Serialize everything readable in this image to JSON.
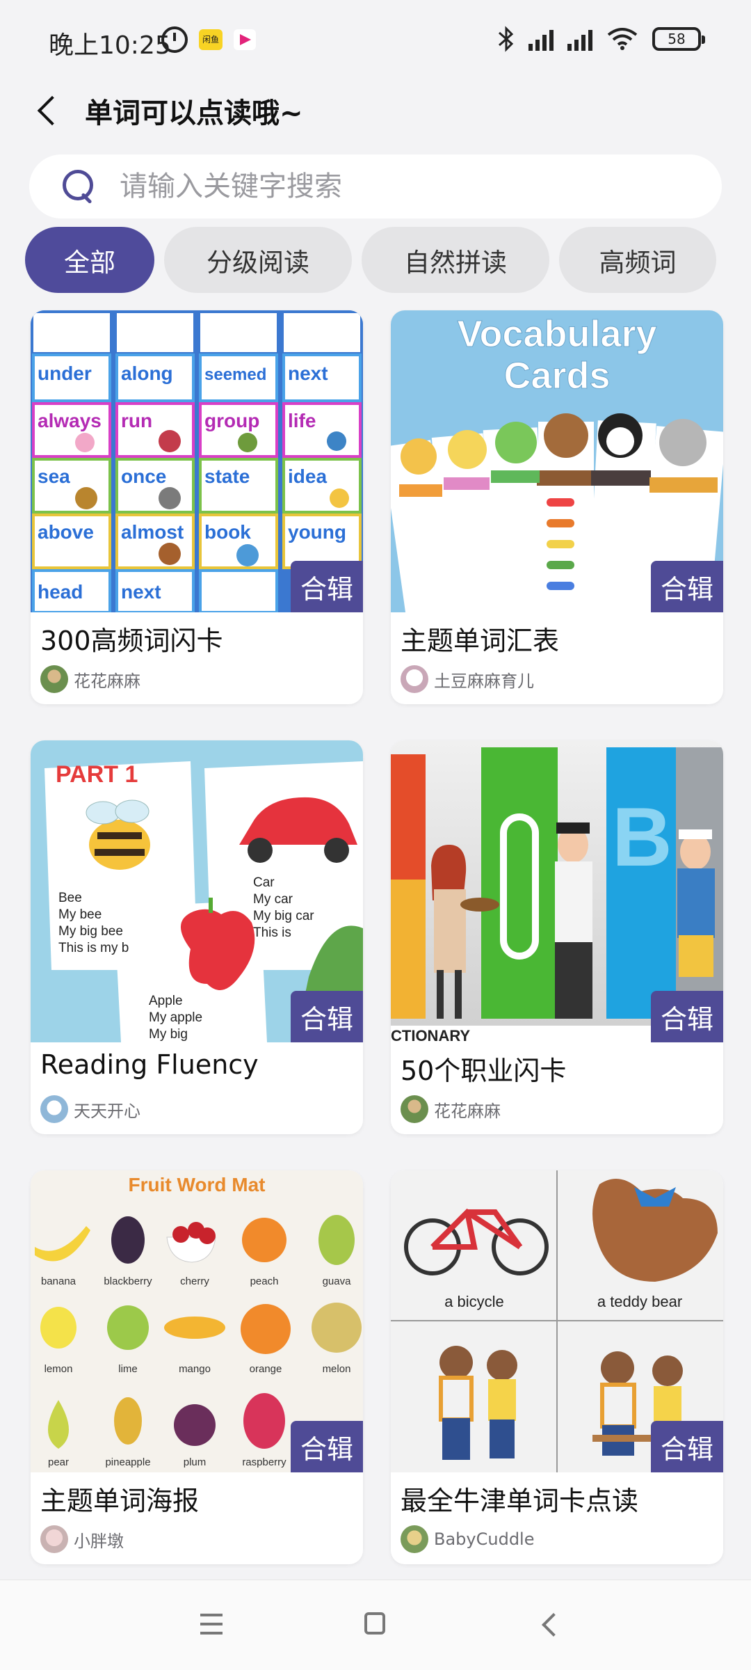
{
  "status_bar": {
    "time": "晚上10:25",
    "app1_badge": "闲鱼",
    "battery": "58"
  },
  "header": {
    "title": "单词可以点读哦~"
  },
  "search": {
    "placeholder": "请输入关键字搜索"
  },
  "tabs": [
    {
      "label": "全部",
      "active": true
    },
    {
      "label": "分级阅读",
      "active": false
    },
    {
      "label": "自然拼读",
      "active": false
    },
    {
      "label": "高频词",
      "active": false
    }
  ],
  "cards": [
    {
      "title": "300高频词闪卡",
      "badge": "合辑",
      "author": "花花麻麻"
    },
    {
      "title": "主题单词汇表",
      "badge": "合辑",
      "author": "土豆麻麻育儿"
    },
    {
      "title": "Reading Fluency",
      "badge": "合辑",
      "author": "天天开心"
    },
    {
      "title": "50个职业闪卡",
      "badge": "合辑",
      "author": "花花麻麻"
    },
    {
      "title": "主题单词海报",
      "badge": "合辑",
      "author": "小胖墩"
    },
    {
      "title": "最全牛津单词卡点读",
      "badge": "合辑",
      "author": "BabyCuddle"
    }
  ],
  "thumb_text": {
    "card1_words": [
      "under",
      "along",
      "seemed",
      "next",
      "always",
      "run",
      "group",
      "life",
      "sea",
      "once",
      "state",
      "idea",
      "above",
      "almost",
      "book",
      "young",
      "head",
      "next"
    ],
    "card2_line1": "Vocabulary",
    "card2_line2": "Cards",
    "card3_part": "PART 1",
    "card3_bee": [
      "Bee",
      "My bee",
      "My big bee",
      "This is my b"
    ],
    "card3_car": [
      "Car",
      "My car",
      "My big car",
      "This is"
    ],
    "card3_apple": [
      "Apple",
      "My apple",
      "My big"
    ],
    "card4_caption": "CTIONARY",
    "card5_heading": "Fruit Word Mat",
    "card5_fruits": [
      "banana",
      "blackberry",
      "cherry",
      "peach",
      "guava",
      "lemon",
      "lime",
      "mango",
      "orange",
      "melon",
      "pear",
      "pineapple",
      "plum",
      "raspberry"
    ],
    "card6_labels": [
      "a bicycle",
      "a teddy bear"
    ]
  }
}
